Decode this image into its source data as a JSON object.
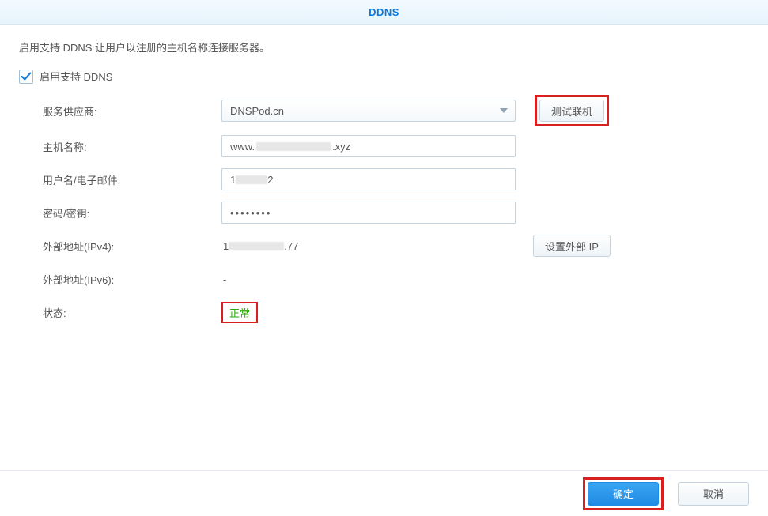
{
  "header": {
    "title": "DDNS"
  },
  "description": "启用支持 DDNS 让用户以注册的主机名称连接服务器。",
  "checkbox": {
    "label": "启用支持 DDNS",
    "checked": true
  },
  "fields": {
    "provider": {
      "label": "服务供应商:",
      "value": "DNSPod.cn",
      "test_button": "测试联机"
    },
    "hostname": {
      "label": "主机名称:",
      "prefix": "www.",
      "suffix": ".xyz"
    },
    "username": {
      "label": "用户名/电子邮件:",
      "prefix": "1",
      "suffix": "2"
    },
    "password": {
      "label": "密码/密钥:",
      "value": "••••••••"
    },
    "ipv4": {
      "label": "外部地址(IPv4):",
      "prefix": "1",
      "suffix": ".77",
      "button": "设置外部 IP"
    },
    "ipv6": {
      "label": "外部地址(IPv6):",
      "value": "-"
    },
    "status": {
      "label": "状态:",
      "value": "正常"
    }
  },
  "footer": {
    "confirm": "确定",
    "cancel": "取消"
  }
}
